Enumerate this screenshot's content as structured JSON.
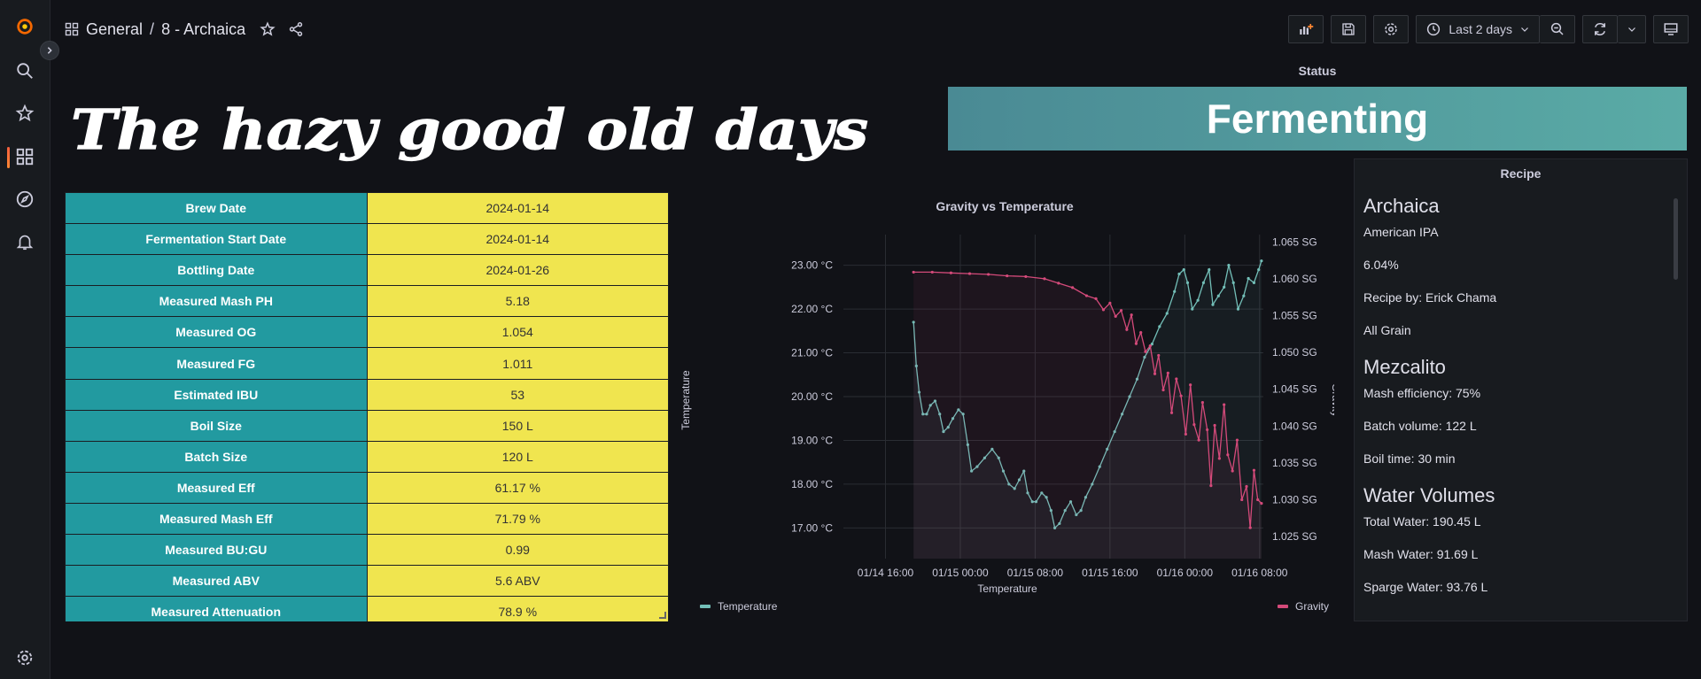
{
  "nav": {
    "items": [
      "home-logo",
      "search",
      "starred",
      "dashboards",
      "explore",
      "alerting",
      "settings"
    ]
  },
  "breadcrumb": {
    "folder": "General",
    "separator": "/",
    "dashboard": "8 - Archaica"
  },
  "toolbar": {
    "time_range": "Last 2 days"
  },
  "banner": {
    "text": "The hazy good old days"
  },
  "status": {
    "title": "Status",
    "value": "Fermenting"
  },
  "brew_table": {
    "rows": [
      {
        "key": "Brew Date",
        "value": "2024-01-14"
      },
      {
        "key": "Fermentation Start Date",
        "value": "2024-01-14"
      },
      {
        "key": "Bottling Date",
        "value": "2024-01-26"
      },
      {
        "key": "Measured Mash PH",
        "value": "5.18"
      },
      {
        "key": "Measured OG",
        "value": "1.054"
      },
      {
        "key": "Measured FG",
        "value": "1.011"
      },
      {
        "key": "Estimated IBU",
        "value": "53"
      },
      {
        "key": "Boil Size",
        "value": "150 L"
      },
      {
        "key": "Batch Size",
        "value": "120 L"
      },
      {
        "key": "Measured Eff",
        "value": "61.17 %"
      },
      {
        "key": "Measured Mash Eff",
        "value": "71.79 %"
      },
      {
        "key": "Measured BU:GU",
        "value": "0.99"
      },
      {
        "key": "Measured ABV",
        "value": "5.6 ABV"
      },
      {
        "key": "Measured Attenuation",
        "value": "78.9 %"
      }
    ]
  },
  "chart_data": {
    "type": "line",
    "title": "Gravity vs Temperature",
    "xlabel": "Temperature",
    "ylabel_left": "Temperature",
    "ylabel_right": "Gravity",
    "x_ticks": [
      "01/14 16:00",
      "01/15 00:00",
      "01/15 08:00",
      "01/15 16:00",
      "01/16 00:00",
      "01/16 08:00"
    ],
    "y_left_ticks": [
      "17.00 °C",
      "18.00 °C",
      "19.00 °C",
      "20.00 °C",
      "21.00 °C",
      "22.00 °C",
      "23.00 °C"
    ],
    "y_right_ticks": [
      "1.025 SG",
      "1.030 SG",
      "1.035 SG",
      "1.040 SG",
      "1.045 SG",
      "1.050 SG",
      "1.055 SG",
      "1.060 SG",
      "1.065 SG"
    ],
    "x_hours": [
      -8,
      0,
      8,
      16,
      24,
      32
    ],
    "y_left_range": [
      16.3,
      23.7
    ],
    "y_right_range": [
      1.022,
      1.066
    ],
    "series": [
      {
        "name": "Temperature",
        "axis": "left",
        "color": "#73bfb8",
        "points": [
          [
            -5,
            21.7
          ],
          [
            -4.7,
            20.7
          ],
          [
            -4.4,
            20.1
          ],
          [
            -4,
            19.6
          ],
          [
            -3.6,
            19.6
          ],
          [
            -3.2,
            19.8
          ],
          [
            -2.7,
            19.9
          ],
          [
            -2.2,
            19.6
          ],
          [
            -1.8,
            19.2
          ],
          [
            -1.3,
            19.3
          ],
          [
            -0.8,
            19.5
          ],
          [
            -0.2,
            19.7
          ],
          [
            0.3,
            19.6
          ],
          [
            0.8,
            18.9
          ],
          [
            1.2,
            18.3
          ],
          [
            1.8,
            18.4
          ],
          [
            2.6,
            18.6
          ],
          [
            3.4,
            18.8
          ],
          [
            4.1,
            18.6
          ],
          [
            4.6,
            18.3
          ],
          [
            5.2,
            18.0
          ],
          [
            5.8,
            17.9
          ],
          [
            6.3,
            18.1
          ],
          [
            6.8,
            18.3
          ],
          [
            7.2,
            17.8
          ],
          [
            7.7,
            17.6
          ],
          [
            8.1,
            17.6
          ],
          [
            8.7,
            17.8
          ],
          [
            9.2,
            17.7
          ],
          [
            9.7,
            17.4
          ],
          [
            10.1,
            17.0
          ],
          [
            10.6,
            17.1
          ],
          [
            11.2,
            17.4
          ],
          [
            11.8,
            17.6
          ],
          [
            12.4,
            17.3
          ],
          [
            12.9,
            17.4
          ],
          [
            13.4,
            17.7
          ],
          [
            14.1,
            18.0
          ],
          [
            14.9,
            18.4
          ],
          [
            15.7,
            18.8
          ],
          [
            16.5,
            19.2
          ],
          [
            17.3,
            19.6
          ],
          [
            18.1,
            20.0
          ],
          [
            18.9,
            20.4
          ],
          [
            19.7,
            20.9
          ],
          [
            20.5,
            21.2
          ],
          [
            21.3,
            21.6
          ],
          [
            22.1,
            21.9
          ],
          [
            22.9,
            22.4
          ],
          [
            23.4,
            22.8
          ],
          [
            23.9,
            22.9
          ],
          [
            24.3,
            22.6
          ],
          [
            24.8,
            22.0
          ],
          [
            25.4,
            22.2
          ],
          [
            26.0,
            22.6
          ],
          [
            26.6,
            22.9
          ],
          [
            27.0,
            22.1
          ],
          [
            27.6,
            22.3
          ],
          [
            28.2,
            22.5
          ],
          [
            28.7,
            23.0
          ],
          [
            29.2,
            22.6
          ],
          [
            29.7,
            22.0
          ],
          [
            30.3,
            22.3
          ],
          [
            30.8,
            22.7
          ],
          [
            31.4,
            22.6
          ],
          [
            31.9,
            22.9
          ],
          [
            32.2,
            23.1
          ]
        ]
      },
      {
        "name": "Gravity",
        "axis": "right",
        "color": "#d44a7a",
        "points": [
          [
            -5,
            1.0609
          ],
          [
            -3,
            1.0609
          ],
          [
            -1,
            1.0608
          ],
          [
            1,
            1.0607
          ],
          [
            3,
            1.0606
          ],
          [
            5,
            1.0604
          ],
          [
            7,
            1.0603
          ],
          [
            9,
            1.06
          ],
          [
            10.5,
            1.0594
          ],
          [
            12,
            1.0588
          ],
          [
            13.5,
            1.0577
          ],
          [
            14.5,
            1.0573
          ],
          [
            15.3,
            1.0558
          ],
          [
            16.0,
            1.0567
          ],
          [
            16.6,
            1.0549
          ],
          [
            17.2,
            1.0557
          ],
          [
            17.8,
            1.0531
          ],
          [
            18.3,
            1.0551
          ],
          [
            18.8,
            1.0512
          ],
          [
            19.3,
            1.0527
          ],
          [
            19.8,
            1.0501
          ],
          [
            20.3,
            1.0509
          ],
          [
            20.8,
            1.0471
          ],
          [
            21.2,
            1.0496
          ],
          [
            21.7,
            1.0449
          ],
          [
            22.2,
            1.0472
          ],
          [
            22.6,
            1.0418
          ],
          [
            23.1,
            1.0464
          ],
          [
            23.6,
            1.0441
          ],
          [
            24.1,
            1.0389
          ],
          [
            24.6,
            1.0456
          ],
          [
            25.0,
            1.0402
          ],
          [
            25.5,
            1.0381
          ],
          [
            25.9,
            1.0432
          ],
          [
            26.4,
            1.0395
          ],
          [
            26.8,
            1.0319
          ],
          [
            27.2,
            1.0401
          ],
          [
            27.7,
            1.0356
          ],
          [
            28.2,
            1.0429
          ],
          [
            28.6,
            1.0361
          ],
          [
            29.1,
            1.0339
          ],
          [
            29.6,
            1.0381
          ],
          [
            30.1,
            1.03
          ],
          [
            30.6,
            1.0318
          ],
          [
            31.0,
            1.0262
          ],
          [
            31.4,
            1.034
          ],
          [
            31.8,
            1.03
          ],
          [
            32.2,
            1.0295
          ]
        ]
      }
    ],
    "legend": [
      {
        "name": "Temperature",
        "position": "bottom-left"
      },
      {
        "name": "Gravity",
        "position": "bottom-right"
      }
    ]
  },
  "recipe": {
    "title": "Recipe",
    "name": "Archaica",
    "style": "American IPA",
    "abv": "6.04%",
    "author": "Recipe by: Erick Chama",
    "type": "All Grain",
    "mash_heading": "Mezcalito",
    "mash_efficiency": "Mash efficiency: 75%",
    "batch_volume": "Batch volume: 122 L",
    "boil_time": "Boil time: 30 min",
    "water_heading": "Water Volumes",
    "total_water": "Total Water: 190.45 L",
    "mash_water": "Mash Water: 91.69 L",
    "sparge_water": "Sparge Water: 93.76 L"
  }
}
